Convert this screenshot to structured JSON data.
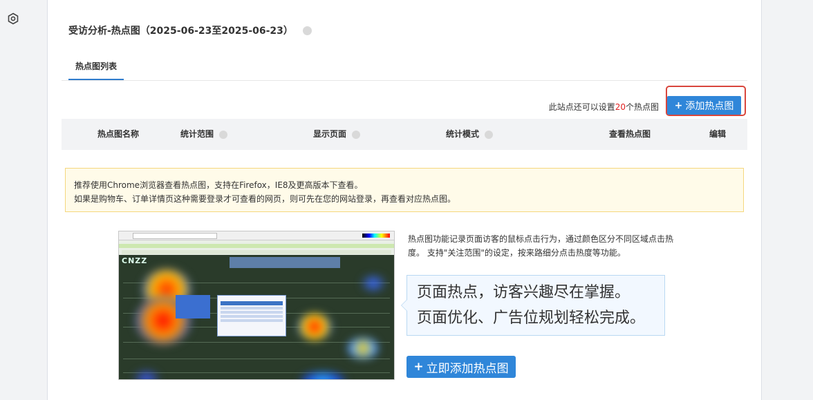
{
  "header": {
    "title": "受访分析-热点图（2025-06-23至2025-06-23）"
  },
  "tabs": [
    {
      "label": "热点图列表",
      "active": true
    }
  ],
  "quota": {
    "prefix": "此站点还可以设置",
    "count": "20",
    "suffix": "个热点图"
  },
  "toolbar": {
    "add_label": "添加热点图"
  },
  "table": {
    "columns": [
      {
        "label": "热点图名称",
        "help": false
      },
      {
        "label": "统计范围",
        "help": true
      },
      {
        "label": "显示页面",
        "help": true
      },
      {
        "label": "统计模式",
        "help": true
      },
      {
        "label": "查看热点图",
        "help": false
      },
      {
        "label": "编辑",
        "help": false
      }
    ]
  },
  "tip": {
    "line1": "推荐使用Chrome浏览器查看热点图，支持在Firefox，IE8及更高版本下查看。",
    "line2": "如果是购物车、订单详情页这种需要登录才可查看的网页，则可先在您的网站登录，再查看对应热点图。"
  },
  "preview": {
    "logo": "CNZZ"
  },
  "intro": {
    "description": "热点图功能记录页面访客的鼠标点击行为，通过颜色区分不同区域点击热度。 支持\"关注范围\"的设定，按来路细分点击热度等功能。",
    "slogan_line1": "页面热点，访客兴趣尽在掌握。",
    "slogan_line2": "页面优化、广告位规划轻松完成。",
    "cta_label": "立即添加热点图"
  },
  "colors": {
    "primary": "#2f86d9",
    "highlight_border": "#d9463c",
    "quota_number": "#e02020",
    "tip_bg": "#fffbe9",
    "tip_border": "#f5d77e"
  }
}
